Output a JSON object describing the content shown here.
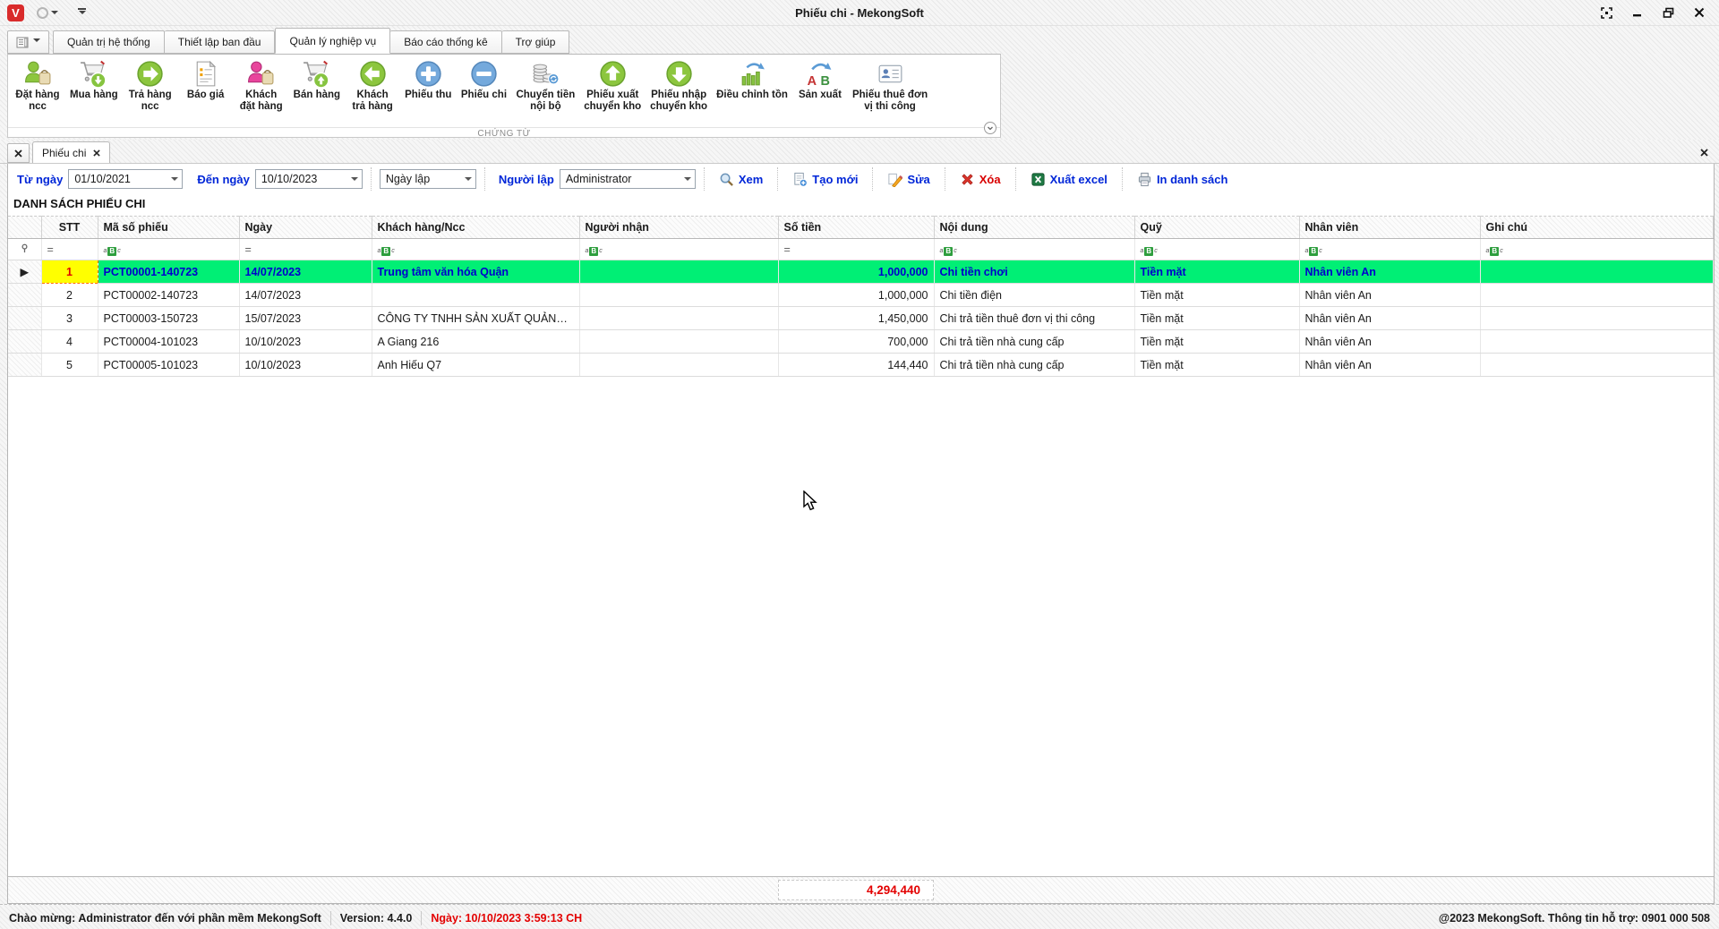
{
  "window": {
    "title": "Phiếu chi - MekongSoft",
    "logo_letter": "V"
  },
  "menu_tabs": [
    {
      "label": "Quản trị hệ thống"
    },
    {
      "label": "Thiết lập ban đầu"
    },
    {
      "label": "Quản lý nghiệp vụ"
    },
    {
      "label": "Báo cáo thống kê"
    },
    {
      "label": "Trợ giúp"
    }
  ],
  "ribbon": {
    "group_label": "CHỨNG TỪ",
    "icon_letters": {
      "a": "A",
      "b": "B"
    },
    "items": [
      {
        "label": "Đặt hàng\nncc",
        "icon": "person-bag-green"
      },
      {
        "label": "Mua hàng",
        "icon": "cart-arrow-down"
      },
      {
        "label": "Trả hàng\nncc",
        "icon": "circle-arrow-right"
      },
      {
        "label": "Báo giá",
        "icon": "quote-document"
      },
      {
        "label": "Khách\nđặt hàng",
        "icon": "person-bag-pink"
      },
      {
        "label": "Bán hàng",
        "icon": "cart-arrow-up"
      },
      {
        "label": "Khách\ntrả hàng",
        "icon": "circle-arrow-left"
      },
      {
        "label": "Phiếu thu",
        "icon": "circle-plus-blue"
      },
      {
        "label": "Phiếu chi",
        "icon": "circle-minus-blue"
      },
      {
        "label": "Chuyển tiền\nnội bộ",
        "icon": "coins-transfer"
      },
      {
        "label": "Phiếu xuất\nchuyển kho",
        "icon": "circle-arrow-up"
      },
      {
        "label": "Phiếu nhập\nchuyển kho",
        "icon": "circle-arrow-down2"
      },
      {
        "label": "Điều chỉnh tồn",
        "icon": "bars-adjust"
      },
      {
        "label": "Sản xuất",
        "icon": "ab-convert"
      },
      {
        "label": "Phiếu thuê đơn\nvị thi công",
        "icon": "id-card"
      }
    ]
  },
  "doc_tabs": {
    "active_label": "Phiếu chi"
  },
  "filter_bar": {
    "tu_ngay_label": "Từ ngày",
    "tu_ngay_value": "01/10/2021",
    "den_ngay_label": "Đến ngày",
    "den_ngay_value": "10/10/2023",
    "ngay_lap_value": "Ngày lập",
    "nguoi_lap_label": "Người lập",
    "nguoi_lap_value": "Administrator",
    "buttons": [
      {
        "label": "Xem",
        "icon": "magnifier-icon"
      },
      {
        "label": "Tạo mới",
        "icon": "new-document-icon"
      },
      {
        "label": "Sửa",
        "icon": "edit-pencil-icon"
      },
      {
        "label": "Xóa",
        "icon": "delete-x-icon"
      },
      {
        "label": "Xuất excel",
        "icon": "excel-icon"
      },
      {
        "label": "In danh sách",
        "icon": "printer-icon"
      }
    ]
  },
  "section_title": "DANH SÁCH PHIẾU CHI",
  "grid": {
    "columns": [
      "STT",
      "Mã số phiếu",
      "Ngày",
      "Khách hàng/Ncc",
      "Người nhận",
      "Số tiền",
      "Nội dung",
      "Quỹ",
      "Nhân viên",
      "Ghi chú"
    ],
    "eq_glyph": "=",
    "abc_icon": {
      "a": "a",
      "b": "B",
      "c": "c"
    },
    "row_indicator_glyph": "▶",
    "rows": [
      {
        "stt": "1",
        "ma_so_phieu": "PCT00001-140723",
        "ngay": "14/07/2023",
        "khach_hang": "Trung tâm văn hóa Quận",
        "nguoi_nhan": "",
        "so_tien": "1,000,000",
        "noi_dung": "Chi tiền chơi",
        "quy": "Tiền mặt",
        "nhan_vien": "Nhân viên An",
        "ghi_chu": ""
      },
      {
        "stt": "2",
        "ma_so_phieu": "PCT00002-140723",
        "ngay": "14/07/2023",
        "khach_hang": "",
        "nguoi_nhan": "",
        "so_tien": "1,000,000",
        "noi_dung": "Chi tiền điện",
        "quy": "Tiền mặt",
        "nhan_vien": "Nhân viên An",
        "ghi_chu": ""
      },
      {
        "stt": "3",
        "ma_so_phieu": "PCT00003-150723",
        "ngay": "15/07/2023",
        "khach_hang": "CÔNG TY TNHH SẢN XUẤT QUẢNG...",
        "nguoi_nhan": "",
        "so_tien": "1,450,000",
        "noi_dung": "Chi trả tiền thuê đơn vị thi công",
        "quy": "Tiền mặt",
        "nhan_vien": "Nhân viên An",
        "ghi_chu": ""
      },
      {
        "stt": "4",
        "ma_so_phieu": "PCT00004-101023",
        "ngay": "10/10/2023",
        "khach_hang": "A Giang 216",
        "nguoi_nhan": "",
        "so_tien": "700,000",
        "noi_dung": "Chi trả tiền nhà cung cấp",
        "quy": "Tiền mặt",
        "nhan_vien": "Nhân viên An",
        "ghi_chu": ""
      },
      {
        "stt": "5",
        "ma_so_phieu": "PCT00005-101023",
        "ngay": "10/10/2023",
        "khach_hang": "Anh Hiếu Q7",
        "nguoi_nhan": "",
        "so_tien": "144,440",
        "noi_dung": "Chi trả tiền nhà cung cấp",
        "quy": "Tiền mặt",
        "nhan_vien": "Nhân viên An",
        "ghi_chu": ""
      }
    ],
    "total_so_tien": "4,294,440"
  },
  "status_bar": {
    "welcome": "Chào mừng: Administrator đến với phần mềm MekongSoft",
    "version": "Version: 4.4.0",
    "date": "Ngày: 10/10/2023 3:59:13 CH",
    "support": "@2023 MekongSoft. Thông tin hỗ trợ: 0901 000 508"
  },
  "colors": {
    "accent_blue": "#0026d8",
    "danger_red": "#d80000",
    "selected_row_green": "#00ef75",
    "selected_text_blue": "#0000cd",
    "stt_highlight_yellow": "#ffff00",
    "total_red": "#e30000"
  }
}
